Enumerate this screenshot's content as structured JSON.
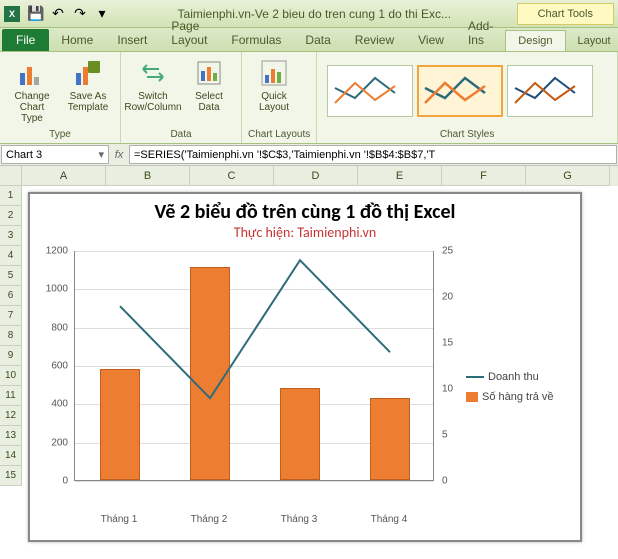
{
  "titlebar": {
    "title": "Taimienphi.vn-Ve 2 bieu do tren cung 1 do thi Exc...",
    "chart_tools": "Chart Tools"
  },
  "qat": {
    "save": "💾",
    "undo": "↶",
    "redo": "↷"
  },
  "tabs": {
    "file": "File",
    "home": "Home",
    "insert": "Insert",
    "pagelayout": "Page Layout",
    "formulas": "Formulas",
    "data": "Data",
    "review": "Review",
    "view": "View",
    "addins": "Add-Ins",
    "design": "Design",
    "layout": "Layout"
  },
  "ribbon": {
    "type_group": "Type",
    "data_group": "Data",
    "layouts_group": "Chart Layouts",
    "styles_group": "Chart Styles",
    "change_chart": "Change Chart Type",
    "save_template": "Save As Template",
    "switch": "Switch Row/Column",
    "select": "Select Data",
    "quick": "Quick Layout"
  },
  "namebox": "Chart 3",
  "formula": "=SERIES('Taimienphi.vn '!$C$3,'Taimienphi.vn '!$B$4:$B$7,'T",
  "cols": [
    "A",
    "B",
    "C",
    "D",
    "E",
    "F",
    "G"
  ],
  "rows": [
    "1",
    "2",
    "3",
    "4",
    "5",
    "6",
    "7",
    "8",
    "9",
    "10",
    "11",
    "12",
    "13",
    "14",
    "15"
  ],
  "chart": {
    "title": "Vẽ 2 biểu đồ trên cùng 1 đồ thị Excel",
    "subtitle": "Thực hiện: Taimienphi.vn",
    "legend1": "Doanh thu",
    "legend2": "Số hàng trả về"
  },
  "chart_data": {
    "type": "bar+line",
    "categories": [
      "Tháng 1",
      "Tháng 2",
      "Tháng 3",
      "Tháng 4"
    ],
    "series": [
      {
        "name": "Doanh thu",
        "type": "line",
        "axis": "right",
        "values": [
          19,
          9,
          24,
          14
        ]
      },
      {
        "name": "Số hàng trả về",
        "type": "bar",
        "axis": "left",
        "values": [
          580,
          1110,
          480,
          430
        ]
      }
    ],
    "ylim_left": [
      0,
      1200
    ],
    "yticks_left": [
      0,
      200,
      400,
      600,
      800,
      1000,
      1200
    ],
    "ylim_right": [
      0,
      25
    ],
    "yticks_right": [
      0,
      5,
      10,
      15,
      20,
      25
    ]
  }
}
